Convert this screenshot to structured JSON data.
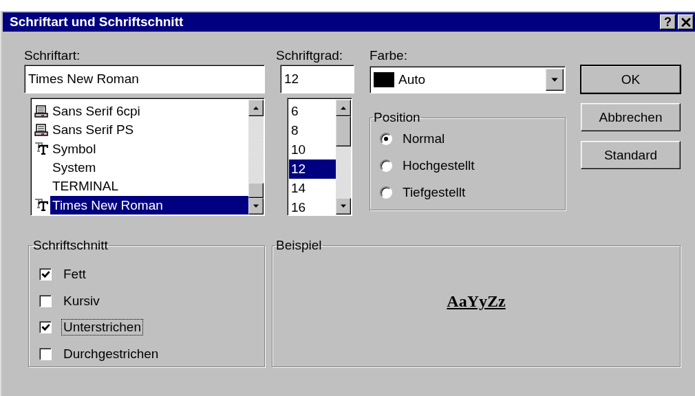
{
  "window": {
    "title": "Schriftart und Schriftschnitt",
    "help_button": "?"
  },
  "font": {
    "label": "Schriftart:",
    "value": "Times New Roman",
    "items": [
      {
        "name": "Sans Serif 6cpi",
        "kind": "printer",
        "selected": false
      },
      {
        "name": "Sans Serif PS",
        "kind": "printer",
        "selected": false
      },
      {
        "name": "Symbol",
        "kind": "truetype",
        "selected": false
      },
      {
        "name": "System",
        "kind": "plain",
        "selected": false
      },
      {
        "name": "TERMINAL",
        "kind": "plain",
        "selected": false
      },
      {
        "name": "Times New Roman",
        "kind": "truetype",
        "selected": true
      }
    ]
  },
  "size": {
    "label": "Schriftgrad:",
    "value": "12",
    "items": [
      {
        "name": "6",
        "selected": false
      },
      {
        "name": "8",
        "selected": false
      },
      {
        "name": "10",
        "selected": false
      },
      {
        "name": "12",
        "selected": true
      },
      {
        "name": "14",
        "selected": false
      },
      {
        "name": "16",
        "selected": false
      }
    ]
  },
  "color": {
    "label": "Farbe:",
    "value": "Auto"
  },
  "position": {
    "title": "Position",
    "options": [
      {
        "label": "Normal",
        "selected": true
      },
      {
        "label": "Hochgestellt",
        "selected": false
      },
      {
        "label": "Tiefgestellt",
        "selected": false
      }
    ]
  },
  "buttons": [
    {
      "label": "OK",
      "default": true
    },
    {
      "label": "Abbrechen",
      "default": false
    },
    {
      "label": "Standard",
      "default": false
    }
  ],
  "style": {
    "title": "Schriftschnitt",
    "options": [
      {
        "label": "Fett",
        "checked": true,
        "focused": false
      },
      {
        "label": "Kursiv",
        "checked": false,
        "focused": false
      },
      {
        "label": "Unterstrichen",
        "checked": true,
        "focused": true
      },
      {
        "label": "Durchgestrichen",
        "checked": false,
        "focused": false
      }
    ]
  },
  "preview": {
    "title": "Beispiel",
    "sample": "AaYyZz"
  }
}
